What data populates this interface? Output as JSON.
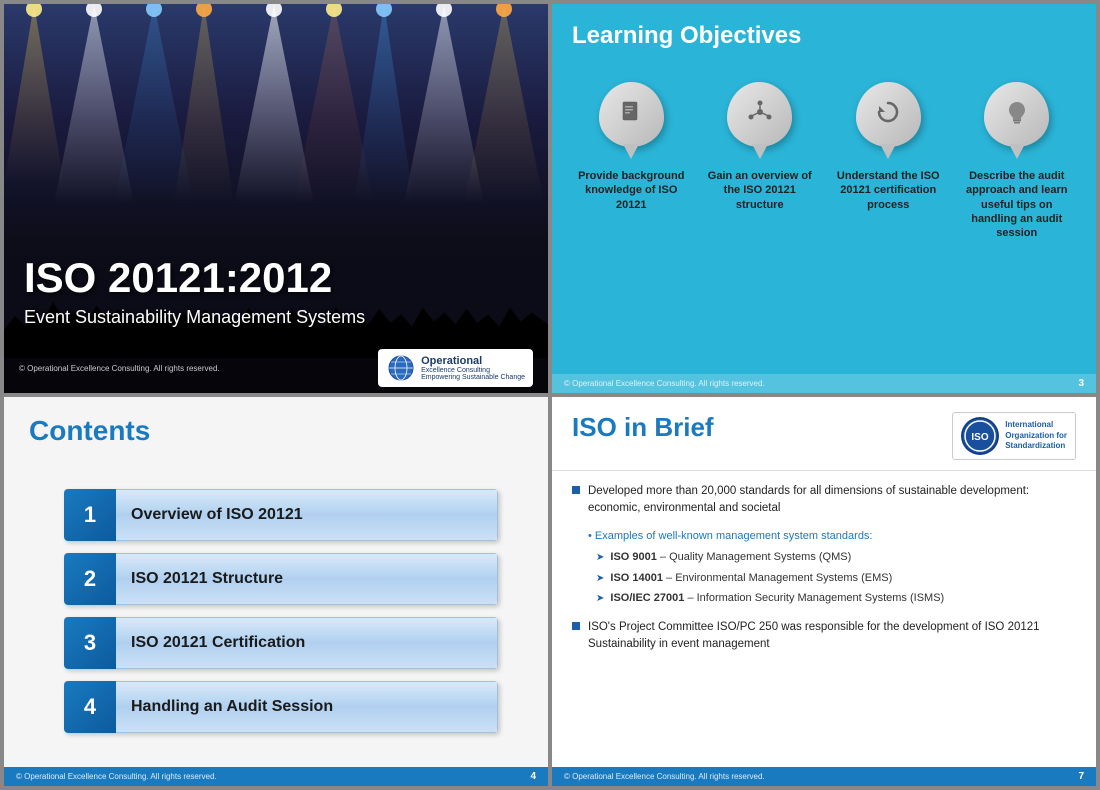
{
  "slide1": {
    "title": "ISO 20121:2012",
    "subtitle": "Event Sustainability Management Systems",
    "footer_text": "© Operational Excellence Consulting.  All rights reserved.",
    "logo_main": "Operational",
    "logo_sub1": "Excellence Consulting",
    "logo_sub2": "Empowering Sustainable Change"
  },
  "slide2": {
    "title": "Learning Objectives",
    "footer_text": "© Operational Excellence Consulting.  All rights reserved.",
    "page": "3",
    "objectives": [
      {
        "symbol": "📄",
        "text": "Provide background knowledge of ISO 20121"
      },
      {
        "symbol": "✦",
        "text": "Gain an overview of the ISO 20121 structure"
      },
      {
        "symbol": "↺",
        "text": "Understand the ISO 20121 certification process"
      },
      {
        "symbol": "💡",
        "text": "Describe the audit approach and learn useful tips on handling an audit session"
      }
    ]
  },
  "slide3": {
    "title": "Contents",
    "footer_text": "© Operational Excellence Consulting.  All rights reserved.",
    "page": "4",
    "items": [
      {
        "num": "1",
        "label": "Overview of ISO 20121"
      },
      {
        "num": "2",
        "label": "ISO 20121 Structure"
      },
      {
        "num": "3",
        "label": "ISO 20121 Certification"
      },
      {
        "num": "4",
        "label": "Handling an Audit Session"
      }
    ]
  },
  "slide4": {
    "title": "ISO in Brief",
    "footer_text": "© Operational Excellence Consulting.  All rights reserved.",
    "page": "7",
    "iso_logo_text": "ISO",
    "iso_org_line1": "International",
    "iso_org_line2": "Organization for",
    "iso_org_line3": "Standardization",
    "bullet1": "Developed more than 20,000 standards for all dimensions of sustainable development: economic, environmental and societal",
    "sub_bullet": "Examples of well-known management system standards:",
    "arrow_items": [
      {
        "bold": "ISO 9001",
        "rest": " – Quality Management Systems (QMS)"
      },
      {
        "bold": "ISO 14001",
        "rest": " – Environmental Management Systems (EMS)"
      },
      {
        "bold": "ISO/IEC 27001",
        "rest": " – Information Security Management Systems (ISMS)"
      }
    ],
    "bullet2": "ISO's Project Committee ISO/PC 250 was responsible for the development of ISO 20121 Sustainability in event management"
  }
}
